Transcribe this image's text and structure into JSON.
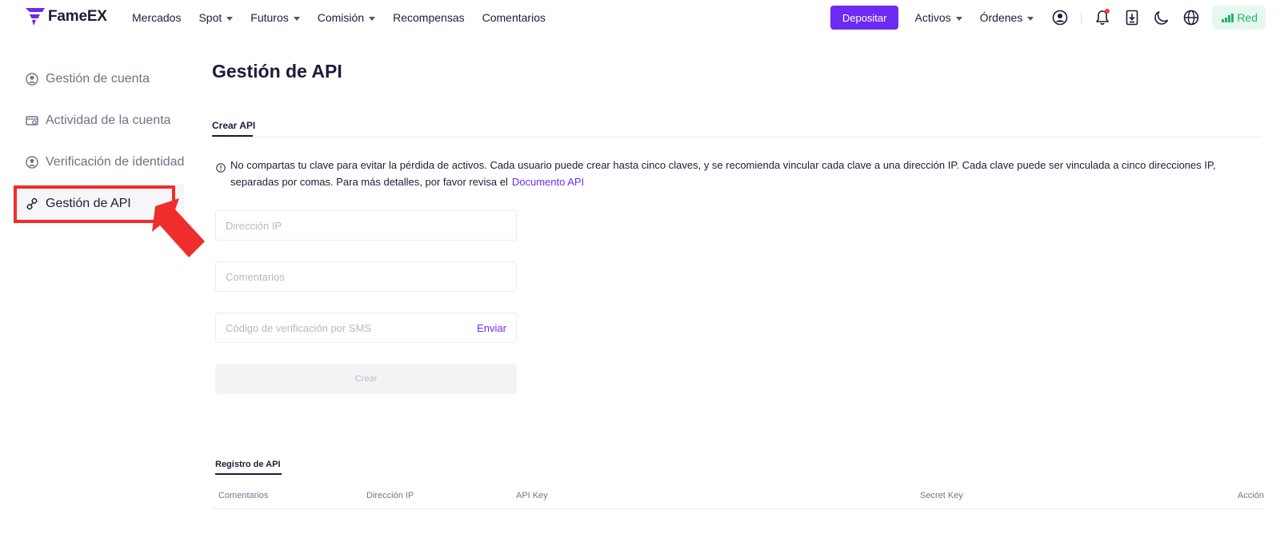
{
  "header": {
    "brand": "FameEX",
    "nav": [
      {
        "label": "Mercados",
        "dropdown": false
      },
      {
        "label": "Spot",
        "dropdown": true
      },
      {
        "label": "Futuros",
        "dropdown": true
      },
      {
        "label": "Comisión",
        "dropdown": true
      },
      {
        "label": "Recompensas",
        "dropdown": false
      },
      {
        "label": "Comentarios",
        "dropdown": false
      }
    ],
    "deposit_label": "Depositar",
    "assets_label": "Activos",
    "orders_label": "Órdenes",
    "network_label": "Red",
    "icons": [
      "user-icon",
      "bell-icon",
      "download-icon",
      "moon-icon",
      "globe-icon",
      "signal-icon"
    ]
  },
  "sidebar": {
    "items": [
      {
        "label": "Gestión de cuenta",
        "icon": "user-circle-icon"
      },
      {
        "label": "Actividad de la cuenta",
        "icon": "wallet-activity-icon"
      },
      {
        "label": "Verificación de identidad",
        "icon": "id-user-icon"
      },
      {
        "label": "Gestión de API",
        "icon": "link-icon",
        "active": true
      }
    ]
  },
  "main": {
    "title": "Gestión de API",
    "tab_create": "Crear API",
    "notice": "No compartas tu clave para evitar la pérdida de activos. Cada usuario puede crear hasta cinco claves, y se recomienda vincular cada clave a una dirección IP. Cada clave puede ser vinculada a cinco direcciones IP, separadas por comas. Para más detalles, por favor revisa el",
    "notice_link": "Documento API",
    "form": {
      "ip_placeholder": "Dirección IP",
      "comments_placeholder": "Comentarios",
      "sms_placeholder": "Código de verificación por SMS",
      "send_label": "Enviar",
      "create_label": "Crear"
    },
    "log": {
      "tab_label": "Registro de API",
      "columns": [
        "Comentarios",
        "Dirección IP",
        "API Key",
        "Secret Key",
        "Acción"
      ]
    }
  },
  "colors": {
    "accent": "#6c2bf2",
    "text": "#1c1c3a",
    "annotation": "#ef2d2d",
    "network": "#22b26a"
  }
}
